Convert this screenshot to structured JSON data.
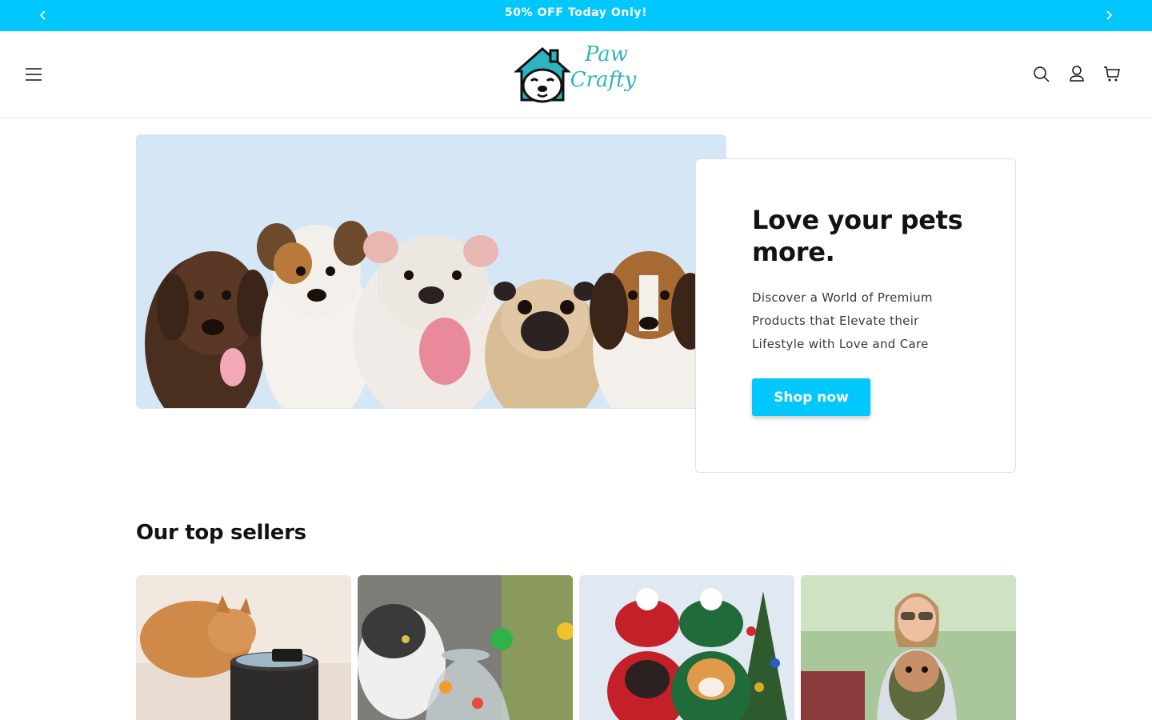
{
  "announcement": {
    "text": "50% OFF Today Only!",
    "prev_icon": "chevron-left-icon",
    "next_icon": "chevron-right-icon"
  },
  "header": {
    "logo_text_line1": "Paw",
    "logo_text_line2": "Crafty",
    "icons": [
      "menu-icon",
      "search-icon",
      "account-icon",
      "cart-icon"
    ]
  },
  "hero": {
    "title": "Love your pets more.",
    "text": "Discover a World of Premium Products that Elevate their Lifestyle with Love and Care",
    "button_label": "Shop now"
  },
  "top_sellers": {
    "title": "Our top sellers"
  },
  "colors": {
    "accent": "#00c8ff",
    "logo_teal": "#2eb3c0",
    "text": "#121212"
  }
}
